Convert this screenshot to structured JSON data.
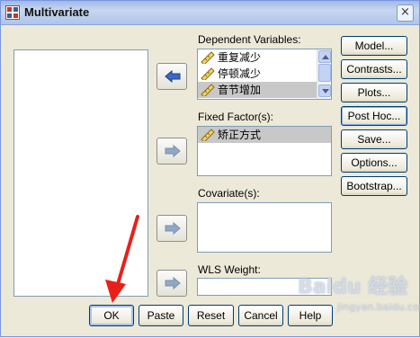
{
  "window": {
    "title": "Multivariate",
    "close_glyph": "×"
  },
  "targets": {
    "dependent_label": "Dependent Variables:",
    "dependent_items": [
      "重复减少",
      "停顿减少",
      "音节增加"
    ],
    "fixed_label": "Fixed Factor(s):",
    "fixed_items": [
      "矫正方式"
    ],
    "covariate_label": "Covariate(s):",
    "wls_label": "WLS Weight:"
  },
  "side_buttons": {
    "model": "Model...",
    "contrasts": "Contrasts...",
    "plots": "Plots...",
    "posthoc": "Post Hoc...",
    "save": "Save...",
    "options": "Options...",
    "bootstrap": "Bootstrap..."
  },
  "bottom_buttons": {
    "ok": "OK",
    "paste": "Paste",
    "reset": "Reset",
    "cancel": "Cancel",
    "help": "Help"
  },
  "watermark": {
    "logo": "Baidu 经验",
    "url": "jingyan.baidu.com"
  },
  "colors": {
    "dialog_bg": "#ece9d8",
    "selection": "#c8c8c8",
    "annotation_arrow": "#e8201a"
  },
  "icons": {
    "scale_variable": "ruler-icon",
    "move_right": "right-arrow-icon",
    "move_left": "left-arrow-icon"
  }
}
